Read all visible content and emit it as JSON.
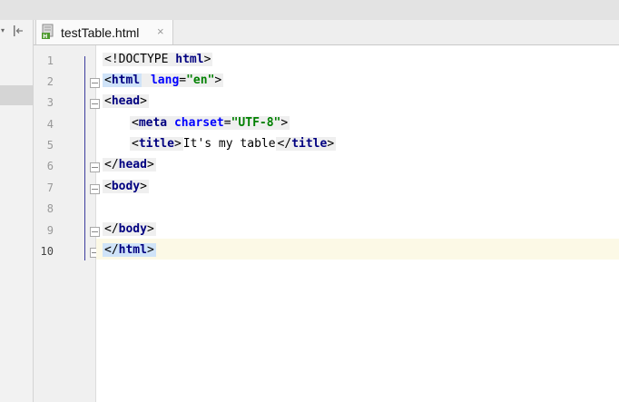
{
  "tab": {
    "label": "testTable.html",
    "close": "×",
    "icon": "html-file-icon"
  },
  "left_panel": {
    "arrow": "▾",
    "collapse_icon": "collapse-icon"
  },
  "editor": {
    "line_numbers": [
      "1",
      "2",
      "3",
      "4",
      "5",
      "6",
      "7",
      "8",
      "9",
      "10"
    ],
    "current_line": "10",
    "lines": {
      "l1": {
        "open": "<",
        "tag": "!DOCTYPE",
        "sp": " ",
        "name": "html",
        "close": ">"
      },
      "l2": {
        "open": "<",
        "tag": "html",
        "sp": " ",
        "attr": "lang",
        "eq": "=",
        "val": "\"en\"",
        "close": ">"
      },
      "l3": {
        "open": "<",
        "tag": "head",
        "close": ">"
      },
      "l4": {
        "open": "<",
        "tag": "meta",
        "sp": " ",
        "attr": "charset",
        "eq": "=",
        "val": "\"UTF-8\"",
        "close": ">"
      },
      "l5": {
        "open": "<",
        "tag": "title",
        "close": ">",
        "text": "It's my table",
        "eopen": "</",
        "etag": "title",
        "eclose": ">"
      },
      "l6": {
        "open": "</",
        "tag": "head",
        "close": ">"
      },
      "l7": {
        "open": "<",
        "tag": "body",
        "close": ">"
      },
      "l9": {
        "open": "</",
        "tag": "body",
        "close": ">"
      },
      "l10": {
        "open": "</",
        "tag": "html",
        "close": ">"
      }
    }
  },
  "colors": {
    "tag": "#000080",
    "attr": "#0000ff",
    "string": "#008000",
    "caret_line": "#fcf9e6",
    "bracket_highlight": "#cfe3f8"
  }
}
